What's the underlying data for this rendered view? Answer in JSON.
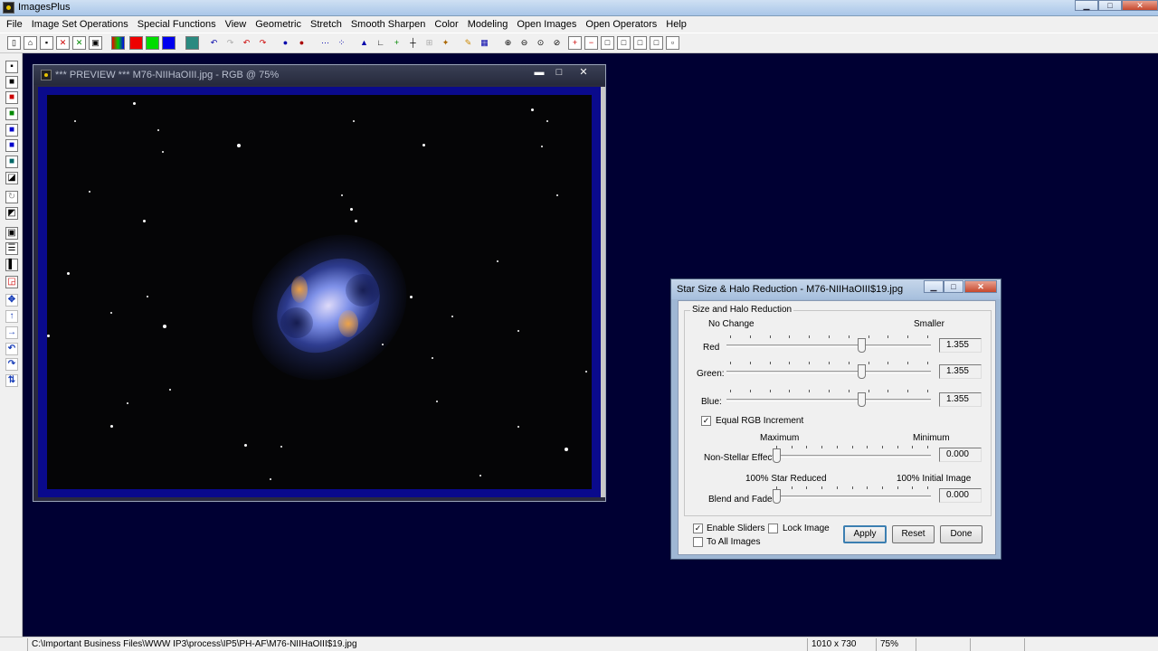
{
  "app": {
    "title": "ImagesPlus",
    "minimize": "▁",
    "maximize": "□",
    "close": "✕"
  },
  "menu": [
    "File",
    "Image Set Operations",
    "Special Functions",
    "View",
    "Geometric",
    "Stretch",
    "Smooth Sharpen",
    "Color",
    "Modeling",
    "Open Images",
    "Open Operators",
    "Help"
  ],
  "preview": {
    "title": "*** PREVIEW *** M76-NIIHaOIII.jpg - RGB @ 75%",
    "minimize": "▬",
    "maximize": "□",
    "close": "✕"
  },
  "dialog": {
    "title": "Star Size & Halo Reduction - M76-NIIHaOIII$19.jpg",
    "group_label": "Size and Halo Reduction",
    "size_left": "No Change",
    "size_right": "Smaller",
    "red_label": "Red",
    "red_value": "1.355",
    "red_position": 0.67,
    "green_label": "Green:",
    "green_value": "1.355",
    "green_position": 0.67,
    "blue_label": "Blue:",
    "blue_value": "1.355",
    "blue_position": 0.67,
    "equal_rgb_label": "Equal RGB Increment",
    "equal_rgb_checked": true,
    "nonstellar_left": "Maximum",
    "nonstellar_right": "Minimum",
    "nonstellar_label": "Non-Stellar Effect:",
    "nonstellar_value": "0.000",
    "nonstellar_position": 0.0,
    "blend_left": "100% Star Reduced",
    "blend_right": "100% Initial Image",
    "blend_label": "Blend and Fade:",
    "blend_value": "0.000",
    "blend_position": 0.0,
    "enable_sliders_label": "Enable Sliders",
    "enable_sliders_checked": true,
    "lock_image_label": "Lock Image",
    "lock_image_checked": false,
    "to_all_images_label": "To All Images",
    "to_all_images_checked": false,
    "apply_label": "Apply",
    "reset_label": "Reset",
    "done_label": "Done"
  },
  "status": {
    "path": "C:\\Important Business Files\\WWW IP3\\process\\IP5\\PH-AF\\M76-NIIHaOIII$19.jpg",
    "dimensions": "1010 x 730",
    "zoom": "75%"
  }
}
